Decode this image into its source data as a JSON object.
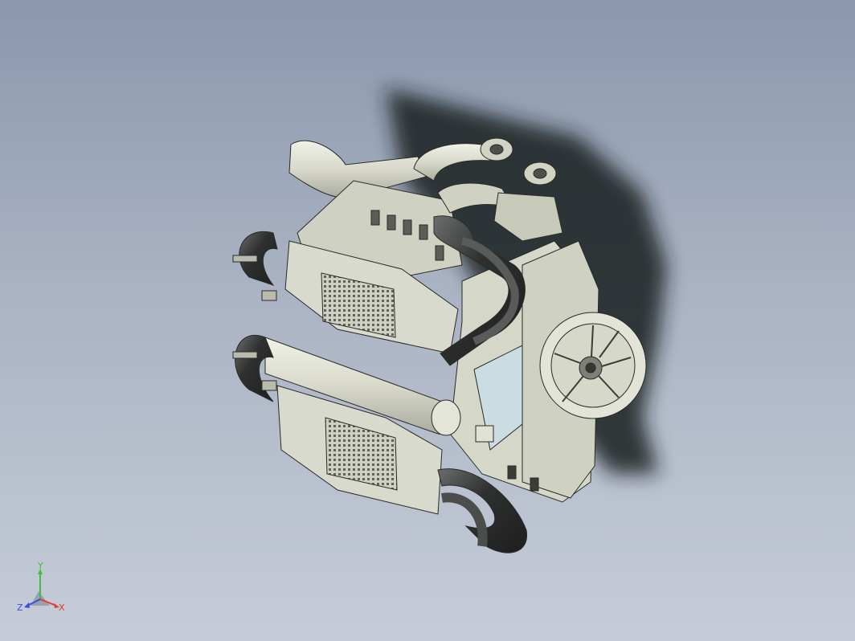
{
  "viewport": {
    "model": "engine-assembly",
    "shaded_with_edges": true,
    "shadow": true,
    "colors": {
      "background_top": "#8a97ad",
      "background_bottom": "#c6ccd8",
      "part_light": "#e2e3d6",
      "part_mid": "#c9cbb9",
      "part_dark": "#8f9285",
      "pipe_dark": "#3b3d3c",
      "fitting_blue": "#c9dde2",
      "shadow": "#1a1c22"
    }
  },
  "triad": {
    "x_label": "X",
    "y_label": "Y",
    "z_label": "Z",
    "colors": {
      "x": "#e33b2e",
      "y": "#3fbf3a",
      "z": "#3a4fe0"
    }
  }
}
